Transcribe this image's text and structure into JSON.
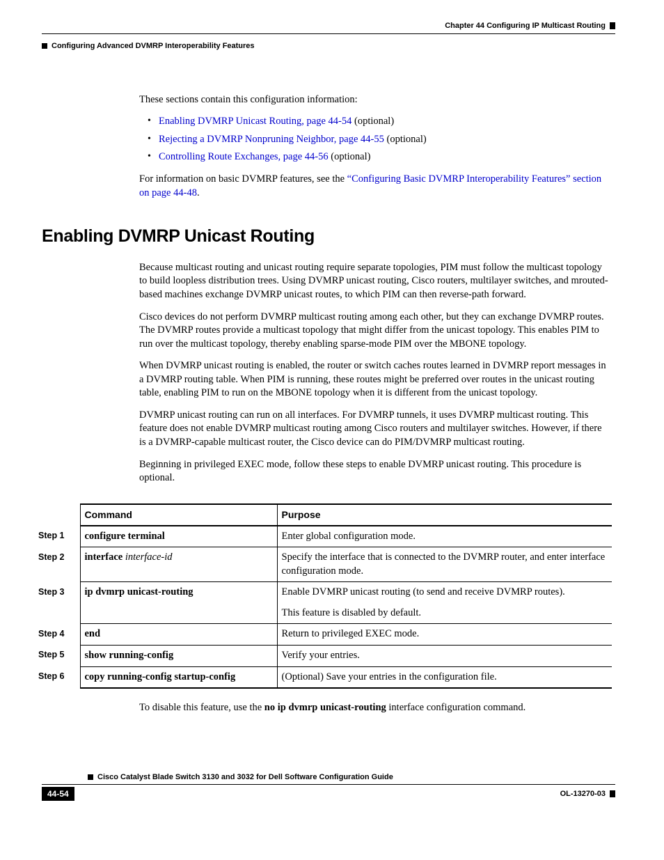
{
  "header": {
    "chapter": "Chapter 44    Configuring IP Multicast Routing",
    "section": "Configuring Advanced DVMRP Interoperability Features"
  },
  "intro": {
    "lead": "These sections contain this configuration information:",
    "bullets": [
      {
        "link": "Enabling DVMRP Unicast Routing, page 44-54",
        "suffix": " (optional)"
      },
      {
        "link": "Rejecting a DVMRP Nonpruning Neighbor, page 44-55",
        "suffix": " (optional)"
      },
      {
        "link": "Controlling Route Exchanges, page 44-56",
        "suffix": " (optional)"
      }
    ],
    "more_prefix": "For information on basic DVMRP features, see the ",
    "more_link": "“Configuring Basic DVMRP Interoperability Features” section on page 44-48",
    "more_suffix": "."
  },
  "heading": "Enabling DVMRP Unicast Routing",
  "paras": [
    "Because multicast routing and unicast routing require separate topologies, PIM must follow the multicast topology to build loopless distribution trees. Using DVMRP unicast routing, Cisco routers, multilayer switches, and mrouted-based machines exchange DVMRP unicast routes, to which PIM can then reverse-path forward.",
    "Cisco devices do not perform DVMRP multicast routing among each other, but they can exchange DVMRP routes. The DVMRP routes provide a multicast topology that might differ from the unicast topology. This enables PIM to run over the multicast topology, thereby enabling sparse-mode PIM over the MBONE topology.",
    "When DVMRP unicast routing is enabled, the router or switch caches routes learned in DVMRP report messages in a DVMRP routing table. When PIM is running, these routes might be preferred over routes in the unicast routing table, enabling PIM to run on the MBONE topology when it is different from the unicast topology.",
    "DVMRP unicast routing can run on all interfaces. For DVMRP tunnels, it uses DVMRP multicast routing. This feature does not enable DVMRP multicast routing among Cisco routers and multilayer switches. However, if there is a DVMRP-capable multicast router, the Cisco device can do PIM/DVMRP multicast routing.",
    "Beginning in privileged EXEC mode, follow these steps to enable DVMRP unicast routing. This procedure is optional."
  ],
  "table": {
    "headers": {
      "command": "Command",
      "purpose": "Purpose"
    },
    "steps": [
      {
        "step": "Step 1",
        "cmd_bold": "configure terminal",
        "cmd_italic": "",
        "purpose": "Enter global configuration mode."
      },
      {
        "step": "Step 2",
        "cmd_bold": "interface",
        "cmd_italic": " interface-id",
        "purpose": "Specify the interface that is connected to the DVMRP router, and enter interface configuration mode."
      },
      {
        "step": "Step 3",
        "cmd_bold": "ip dvmrp unicast-routing",
        "cmd_italic": "",
        "purpose": "Enable DVMRP unicast routing (to send and receive DVMRP routes).",
        "purpose2": "This feature is disabled by default."
      },
      {
        "step": "Step 4",
        "cmd_bold": "end",
        "cmd_italic": "",
        "purpose": "Return to privileged EXEC mode."
      },
      {
        "step": "Step 5",
        "cmd_bold": "show running-config",
        "cmd_italic": "",
        "purpose": "Verify your entries."
      },
      {
        "step": "Step 6",
        "cmd_bold": "copy running-config startup-config",
        "cmd_italic": "",
        "purpose": "(Optional) Save your entries in the configuration file."
      }
    ]
  },
  "disable": {
    "prefix": "To disable this feature, use the ",
    "bold": "no ip dvmrp unicast-routing",
    "suffix": " interface configuration command."
  },
  "footer": {
    "title": "Cisco Catalyst Blade Switch 3130 and 3032 for Dell Software Configuration Guide",
    "page": "44-54",
    "docid": "OL-13270-03"
  }
}
